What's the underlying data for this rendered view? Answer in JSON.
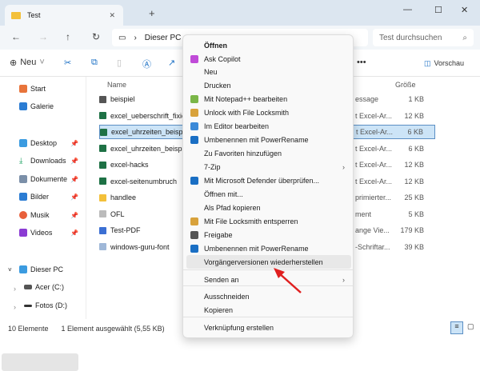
{
  "window": {
    "tab_title": "Test",
    "search_placeholder": "Test durchsuchen",
    "address": "Dieser PC"
  },
  "toolbar": {
    "new_label": "Neu",
    "more": "•••",
    "preview_label": "Vorschau"
  },
  "sidebar": {
    "items": [
      {
        "label": "Start",
        "color": "#e8743b"
      },
      {
        "label": "Galerie",
        "color": "#2b7cd3"
      },
      {
        "label": "Desktop",
        "color": "#3b9be0"
      },
      {
        "label": "Downloads",
        "color": "#1aa260"
      },
      {
        "label": "Dokumente",
        "color": "#7b8fa8"
      },
      {
        "label": "Bilder",
        "color": "#2b7cd3"
      },
      {
        "label": "Musik",
        "color": "#e8603b"
      },
      {
        "label": "Videos",
        "color": "#8b3bd3"
      },
      {
        "label": "Dieser PC",
        "color": "#3b9be0"
      },
      {
        "label": "Acer (C:)",
        "color": "#555555"
      },
      {
        "label": "Fotos (D:)",
        "color": "#333333"
      }
    ]
  },
  "list": {
    "header_name": "Name",
    "header_size": "Größe",
    "rows": [
      {
        "name": "beispiel",
        "type": "essage",
        "size": "1 KB",
        "color": "#555555"
      },
      {
        "name": "excel_ueberschrift_fixier",
        "type": "t Excel-Ar...",
        "size": "12 KB",
        "color": "#1e7145"
      },
      {
        "name": "excel_uhrzeiten_beispie",
        "type": "t Excel-Ar...",
        "size": "6 KB",
        "color": "#1e7145"
      },
      {
        "name": "excel_uhrzeiten_beispie",
        "type": "t Excel-Ar...",
        "size": "6 KB",
        "color": "#1e7145"
      },
      {
        "name": "excel-hacks",
        "type": "t Excel-Ar...",
        "size": "12 KB",
        "color": "#1e7145"
      },
      {
        "name": "excel-seitenumbruch",
        "type": "t Excel-Ar...",
        "size": "12 KB",
        "color": "#1e7145"
      },
      {
        "name": "handlee",
        "type": "primierter...",
        "size": "25 KB",
        "color": "#f3c03a"
      },
      {
        "name": "OFL",
        "type": "ment",
        "size": "5 KB",
        "color": "#bbbbbb"
      },
      {
        "name": "Test-PDF",
        "type": "ange Vie...",
        "size": "179 KB",
        "color": "#3b6fd3"
      },
      {
        "name": "windows-guru-font",
        "type": "-Schriftar...",
        "size": "39 KB",
        "color": "#9fb8d8"
      }
    ]
  },
  "status": {
    "count": "10 Elemente",
    "selection": "1 Element ausgewählt (5,55 KB)"
  },
  "menu": {
    "items": [
      {
        "label": "Öffnen",
        "bold": true
      },
      {
        "label": "Ask Copilot",
        "icon": "#c04bd8"
      },
      {
        "label": "Neu"
      },
      {
        "label": "Drucken"
      },
      {
        "label": "Mit Notepad++ bearbeiten",
        "icon": "#7ab648"
      },
      {
        "label": "Unlock with File Locksmith",
        "icon": "#d8a23b"
      },
      {
        "label": "Im Editor bearbeiten",
        "icon": "#3b8ad8"
      },
      {
        "label": "Umbenennen mit PowerRename",
        "icon": "#1a6fc4"
      },
      {
        "label": "Zu Favoriten hinzufügen"
      },
      {
        "label": "7-Zip",
        "sub": true
      },
      {
        "label": "Mit Microsoft Defender überprüfen...",
        "icon": "#1a6fc4"
      },
      {
        "label": "Öffnen mit..."
      },
      {
        "label": "Als Pfad kopieren"
      },
      {
        "label": "Mit File Locksmith entsperren",
        "icon": "#d8a23b"
      },
      {
        "label": "Freigabe",
        "icon": "#555555"
      },
      {
        "label": "Umbenennen mit PowerRename",
        "icon": "#1a6fc4"
      },
      {
        "label": "Vorgängerversionen wiederherstellen",
        "highlight": true
      },
      {
        "label": "Senden an",
        "sub": true
      },
      {
        "label": "Ausschneiden"
      },
      {
        "label": "Kopieren"
      },
      {
        "label": "Verknüpfung erstellen"
      }
    ],
    "submenu_arrow": "›"
  }
}
